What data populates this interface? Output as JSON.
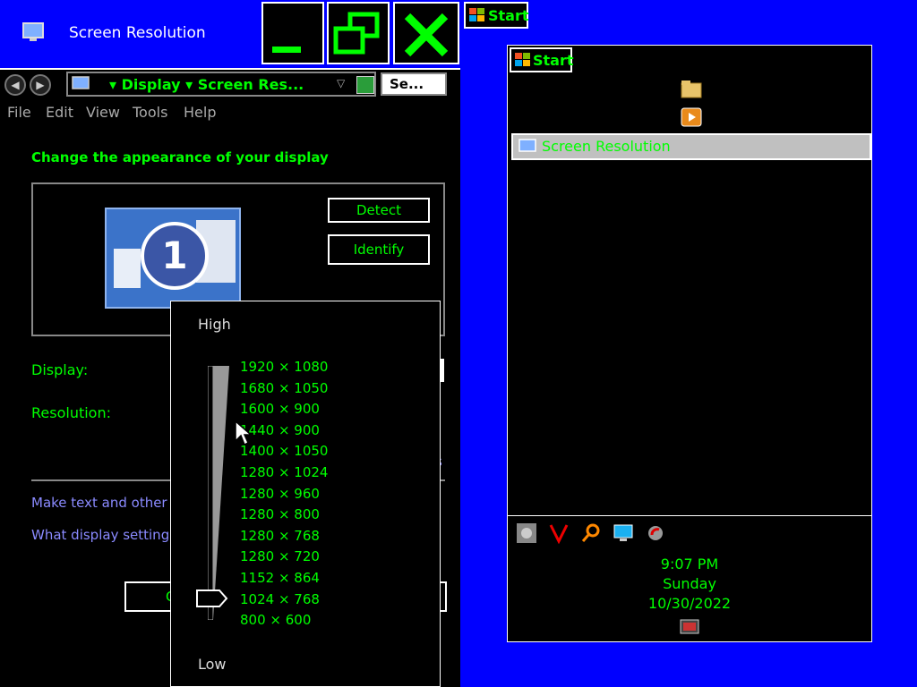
{
  "window": {
    "title": "Screen Resolution",
    "address": "▾ Display ▾ Screen Res...",
    "search_placeholder": "Se...",
    "menu": [
      "File",
      "Edit",
      "View",
      "Tools",
      "Help"
    ]
  },
  "content": {
    "heading": "Change the appearance of your display",
    "monitor_number": "1",
    "detect_label": "Detect",
    "identify_label": "Identify",
    "display_label": "Display:",
    "resolution_label": "Resolution:",
    "link_text_size": "Make text and other i",
    "link_display_settings": "What display settings",
    "partial_button_text": "C",
    "partial_link_fragment": "s"
  },
  "resolution_popup": {
    "high_label": "High",
    "low_label": "Low",
    "options": [
      "1920 × 1080",
      "1680 × 1050",
      "1600 × 900",
      "1440 × 900",
      "1400 × 1050",
      "1280 × 1024",
      "1280 × 960",
      "1280 × 800",
      "1280 × 768",
      "1280 × 720",
      "1152 × 864",
      "1024 × 768",
      "800 × 600"
    ],
    "selected_index": 11
  },
  "start_button_label": "Start",
  "start_menu": {
    "start_label": "Start",
    "selected_item": "Screen Resolution"
  },
  "tray": {
    "time": "9:07 PM",
    "day": "Sunday",
    "date": "10/30/2022"
  },
  "colors": {
    "desktop": "#0000ff",
    "text_accent": "#00ff00",
    "link": "#8a8aff"
  }
}
